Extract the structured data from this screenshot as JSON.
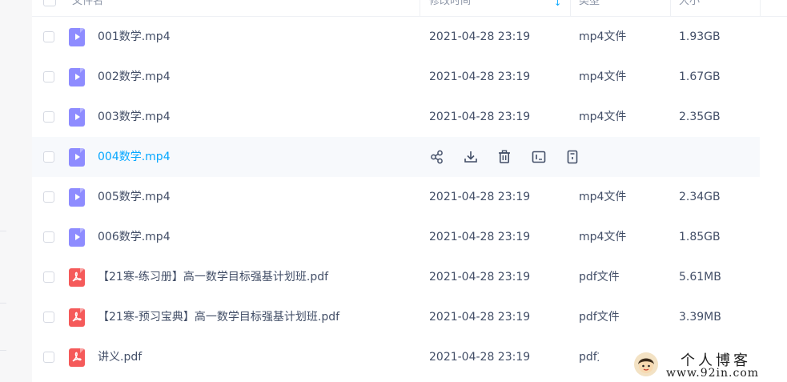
{
  "header": {
    "col_name": "文件名",
    "col_modified": "修改时间",
    "col_type": "类型",
    "col_size": "大小"
  },
  "files": [
    {
      "name": "001数学.mp4",
      "kind": "video",
      "modified": "2021-04-28 23:19",
      "type": "mp4文件",
      "size": "1.93GB"
    },
    {
      "name": "002数学.mp4",
      "kind": "video",
      "modified": "2021-04-28 23:19",
      "type": "mp4文件",
      "size": "1.67GB"
    },
    {
      "name": "003数学.mp4",
      "kind": "video",
      "modified": "2021-04-28 23:19",
      "type": "mp4文件",
      "size": "2.35GB"
    },
    {
      "name": "004数学.mp4",
      "kind": "video",
      "hovered": true
    },
    {
      "name": "005数学.mp4",
      "kind": "video",
      "modified": "2021-04-28 23:19",
      "type": "mp4文件",
      "size": "2.34GB"
    },
    {
      "name": "006数学.mp4",
      "kind": "video",
      "modified": "2021-04-28 23:19",
      "type": "mp4文件",
      "size": "1.85GB"
    },
    {
      "name": "【21寒-练习册】高一数学目标强基计划班.pdf",
      "kind": "pdf",
      "modified": "2021-04-28 23:19",
      "type": "pdf文件",
      "size": "5.61MB"
    },
    {
      "name": "【21寒-预习宝典】高一数学目标强基计划班.pdf",
      "kind": "pdf",
      "modified": "2021-04-28 23:19",
      "type": "pdf文件",
      "size": "3.39MB"
    },
    {
      "name": "讲义.pdf",
      "kind": "pdf",
      "modified": "2021-04-28 23:19",
      "type": "pdf文件",
      "size": ""
    }
  ],
  "hover_actions": [
    "share-icon",
    "download-icon",
    "delete-icon",
    "rename-icon",
    "more-icon"
  ],
  "watermark": {
    "title": "个人博客",
    "url": "www.92in.com"
  },
  "colors": {
    "accent": "#06a7ff",
    "video_icon": "#8e8cff",
    "pdf_icon": "#f55a5a",
    "text": "#424e67"
  }
}
